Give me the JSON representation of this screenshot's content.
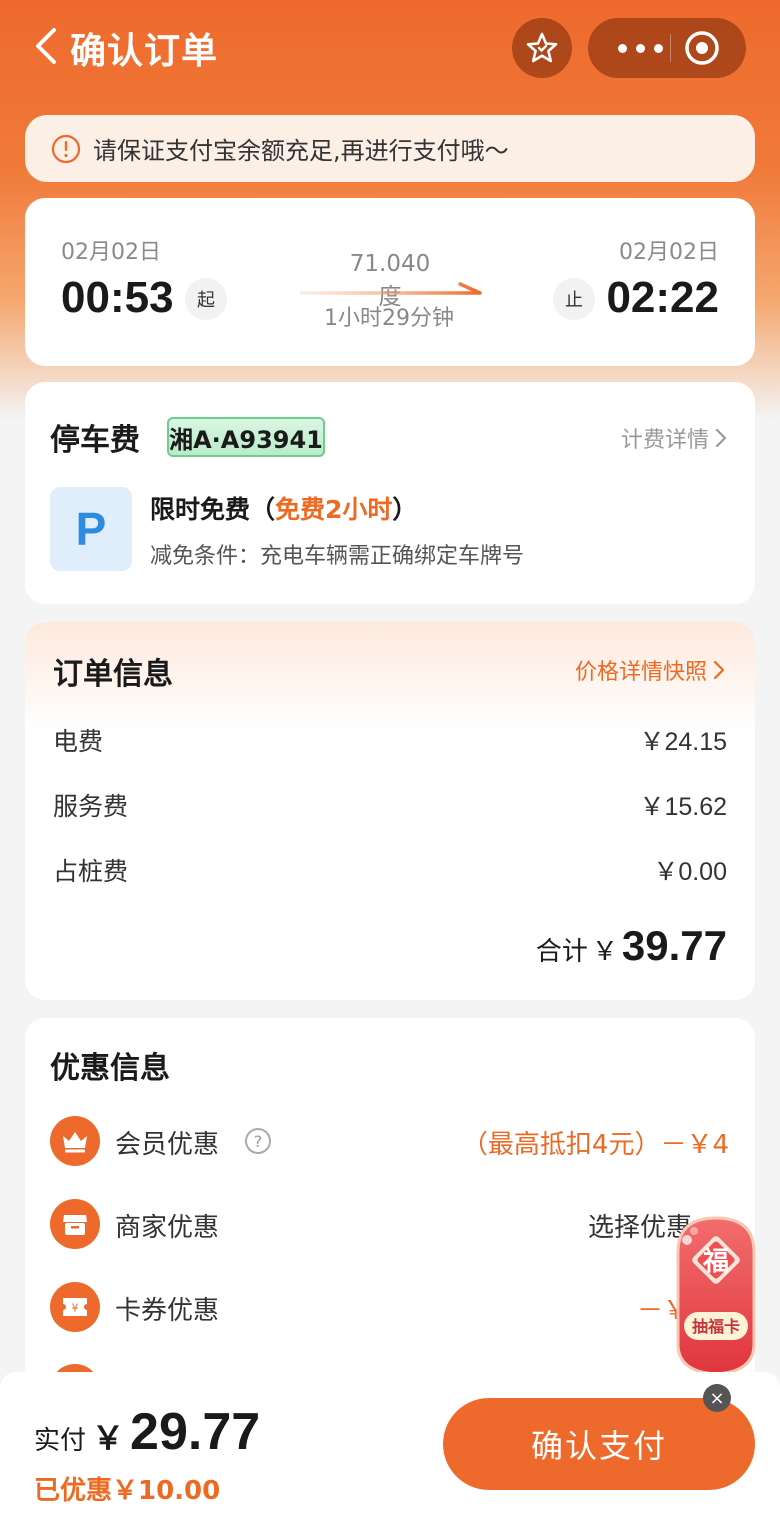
{
  "nav": {
    "title": "确认订单"
  },
  "notice": {
    "text": "请保证支付宝余额充足,再进行支付哦～"
  },
  "charging": {
    "start_date": "02月02日",
    "start_time": "00:53",
    "start_badge": "起",
    "end_date": "02月02日",
    "end_time": "02:22",
    "end_badge": "止",
    "energy": "71.040度",
    "duration": "1小时29分钟"
  },
  "parking": {
    "title": "停车费",
    "plate": "湘A·A93941",
    "detail_link": "计费详情",
    "icon_letter": "P",
    "free_label": "限时免费（",
    "free_highlight": "免费2小时",
    "free_close": "）",
    "condition": "减免条件：充电车辆需正确绑定车牌号"
  },
  "order": {
    "title": "订单信息",
    "snapshot_link": "价格详情快照",
    "rows": [
      {
        "label": "电费",
        "value": "￥24.15"
      },
      {
        "label": "服务费",
        "value": "￥15.62"
      },
      {
        "label": "占桩费",
        "value": "￥0.00"
      }
    ],
    "total_label": "合计",
    "total_symbol": "￥",
    "total_amount": "39.77"
  },
  "discounts": {
    "title": "优惠信息",
    "items": [
      {
        "label": "会员优惠",
        "value": "（最高抵扣4元）－￥4"
      },
      {
        "label": "商家优惠",
        "value": "选择优惠"
      },
      {
        "label": "卡券优惠",
        "value": "－￥"
      }
    ]
  },
  "promo": {
    "char": "福",
    "label": "抽福卡"
  },
  "bottom": {
    "pay_label": "实付",
    "pay_symbol": "￥",
    "pay_amount": "29.77",
    "saved": "已优惠￥10.00",
    "confirm": "确认支付"
  },
  "colors": {
    "accent": "#ee6a2c",
    "plate_green": "#6ccd8f",
    "parking_blue": "#2f8be0"
  }
}
